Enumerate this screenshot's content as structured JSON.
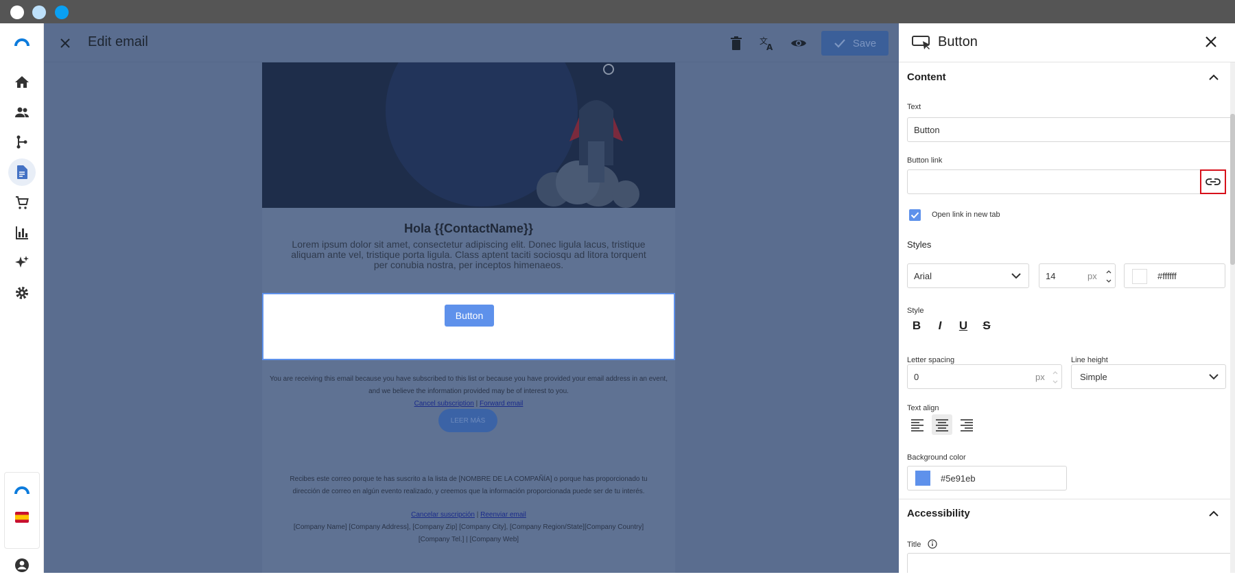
{
  "window": {
    "dots": [
      "#ffffff",
      "#bde0fa",
      "#0aa0f2"
    ]
  },
  "nav": {
    "items": [
      "home",
      "contacts",
      "flows",
      "templates",
      "shop",
      "reports",
      "ai",
      "settings"
    ],
    "bottom": [
      "brand-logo",
      "language-es-flag",
      "account"
    ]
  },
  "editor": {
    "title": "Edit email",
    "save_label": "Save",
    "greeting": "Hola {{ContactName}}",
    "lorem": "Lorem ipsum dolor sit amet, consectetur adipiscing elit. Donec ligula lacus, tristique aliquam ante vel, tristique porta ligula. Class aptent taciti sociosqu ad litora torquent per conubia nostra, per inceptos himenaeos.",
    "button_label": "Button",
    "footer_en_1": "You are receiving this email because you have subscribed to this list or because you have provided your email address in an event,",
    "footer_en_2": "and we believe the information provided may be of interest to you.",
    "cancel_sub": "Cancel subscription",
    "sep": "|",
    "forward": "Forward email",
    "leer_mas": "LEER MÁS",
    "footer_es_1": "Recibes este correo porque te has suscrito a la lista de [NOMBRE DE LA COMPAÑÍA] o porque has proporcionado tu",
    "footer_es_2": "dirección de correo en algún evento realizado, y creemos que la información proporcionada puede ser de tu interés.",
    "cancelar": "Cancelar suscripción",
    "reenviar": "Reenviar email",
    "company_1": "[Company Name] [Company Address], [Company Zip] [Company City], [Company Region/State][Company Country]",
    "company_2": "[Company Tel.] | [Company Web]"
  },
  "panel": {
    "title": "Button",
    "content_title": "Content",
    "text_label": "Text",
    "text_value": "Button",
    "link_label": "Button link",
    "link_value": "",
    "new_tab_label": "Open link in new tab",
    "new_tab_checked": true,
    "styles_title": "Styles",
    "font": "Arial",
    "size": "14",
    "px": "px",
    "text_color": "#ffffff",
    "style_label": "Style",
    "style_buttons": [
      "B",
      "I",
      "U",
      "S"
    ],
    "letter_spacing_label": "Letter spacing",
    "letter_spacing_value": "0",
    "line_height_label": "Line height",
    "line_height_value": "Simple",
    "text_align_label": "Text align",
    "text_align_selected": "center",
    "bg_label": "Background color",
    "bg_value": "#5e91eb",
    "accessibility_title": "Accessibility",
    "title_label": "Title"
  }
}
